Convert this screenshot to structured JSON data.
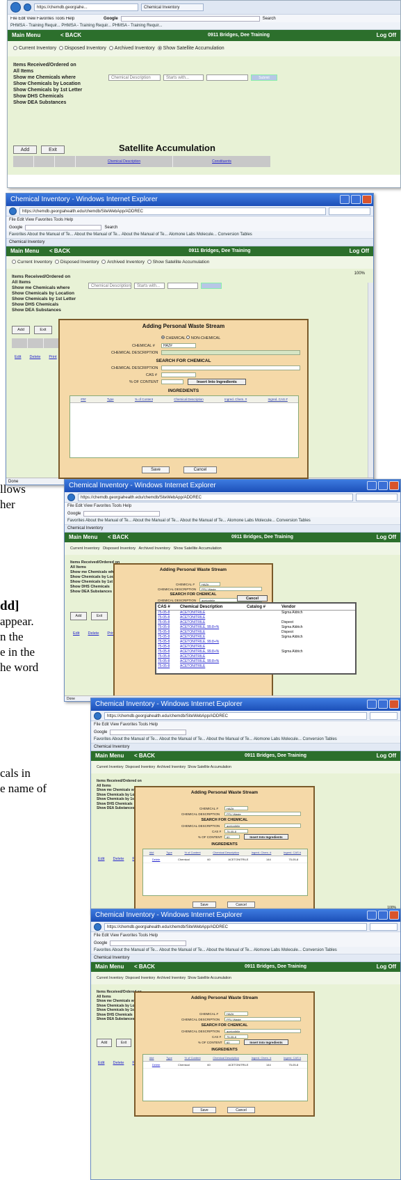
{
  "doc": {
    "frag1": [
      "llows",
      "",
      "her"
    ],
    "frag2_bold": "dd]",
    "frag2": [
      "appear.",
      "",
      "n the",
      "e in the",
      "he word"
    ],
    "frag3": [
      "cals in",
      "",
      "",
      "e name of"
    ]
  },
  "browser": {
    "url_short": "https://chemdb.georgiahe...",
    "tab": "Chemical Inventory",
    "menu": "File  Edit  View  Favorites  Tools  Help",
    "google": "Google",
    "search_btn": "Search",
    "favbar": "Favorites   About the Manual of Te...   About the Manual of Te...   About the Manual of Te...   Alomone Labs Molecule...   Conversion Tables",
    "favbar_top": "PHMSA - Training Requir...   PHMSA - Training Requir...   PHMSA - Training Requir...",
    "title": "Chemical Inventory - Windows Internet Explorer",
    "url": "https://chemdb.georgiahealth.edu/chemdb/SiteWebApp/ADDREC",
    "status_done": "Done",
    "zoom": "100%"
  },
  "app": {
    "nav": {
      "main_menu": "Main Menu",
      "back": "< BACK",
      "center": "0911  Bridges, Dee Training",
      "logoff": "Log Off"
    },
    "radios": [
      "Current Inventory",
      "Disposed Inventory",
      "Archived Inventory",
      "Show Satellite Accumulation"
    ],
    "options": [
      "Items Received/Ordered on",
      "All Items",
      "Show me Chemicals where",
      "Show Chemicals by Location",
      "Show Chemicals by 1st Letter",
      "Show DHS Chemicals",
      "Show DEA Substances"
    ],
    "filter": {
      "field": "Chemical Description",
      "op": "Starts with...",
      "go": "Submit"
    },
    "add_label": "Add",
    "exit_label": "Exit",
    "satellite_title": "Satellite Accumulation",
    "sat_cols": [
      "Chemical Description",
      "Constituents"
    ],
    "row_links": [
      "Edit",
      "Delete",
      "Print"
    ]
  },
  "modal": {
    "title": "Adding Personal Waste Stream",
    "type_chemical": "CHEMICAL",
    "type_nonchemical": "NON-CHEMICAL",
    "chemical_num_label": "CHEMICAL #",
    "chemical_num_value": "HAZ#",
    "chem_desc_label": "CHEMICAL DESCRIPTION",
    "chem_desc_value": "PFLI Waste",
    "search_head": "SEARCH FOR CHEMICAL",
    "search_desc_label": "CHEMICAL DESCRIPTION",
    "search_desc_value": "acetonitrile",
    "cas_label": "CAS #",
    "cas_value": "75-05-8",
    "pct_label": "% OF CONTENT",
    "pct_value": "60",
    "insert_btn": "Insert Into Ingredients",
    "ingredients_head": "INGREDIENTS",
    "cols": [
      "###",
      "Type",
      "% of Content",
      "Chemical Description",
      "Ingred. Chem. #",
      "Ingred. CAS #"
    ],
    "row": [
      "Delete",
      "Chemical",
      "60",
      "ACETONITRILE",
      "144",
      "75-05-8"
    ],
    "save": "Save",
    "cancel": "Cancel",
    "popup_cancel": "Cancel",
    "popup_cols": [
      "CAS #",
      "Chemical Description",
      "Catalog #",
      "Vendor"
    ],
    "popup_rows": [
      [
        "75-05-8",
        "ACETONITRILE",
        "",
        "Sigma Aldrich"
      ],
      [
        "75-05-8",
        "ACETONITRILE",
        "",
        ""
      ],
      [
        "75-05-8",
        "ACETONITRILE",
        "",
        "Dispeot"
      ],
      [
        "75-05-8",
        "ACETONITRILE, 99.8+%",
        "",
        "Sigma Aldrich"
      ],
      [
        "75-05-8",
        "ACETONITRILE",
        "",
        "Dispeot"
      ],
      [
        "75-05-8",
        "ACETONITRILE",
        "",
        "Sigma Aldrich"
      ],
      [
        "75-05-8",
        "ACETONITRILE, 99.8+%",
        "",
        ""
      ],
      [
        "75-05-8",
        "ACETONITRILE",
        "",
        ""
      ],
      [
        "75-05-8",
        "ACETONITRILE, 99.8+%",
        "",
        "Sigma Aldrich"
      ],
      [
        "75-05-8",
        "ACETONITRILE",
        "",
        ""
      ],
      [
        "75-05-8",
        "ACETONITRILE, 99.8+%",
        "",
        ""
      ],
      [
        "75-05-8",
        "ACETONITRILE",
        "",
        ""
      ]
    ]
  }
}
